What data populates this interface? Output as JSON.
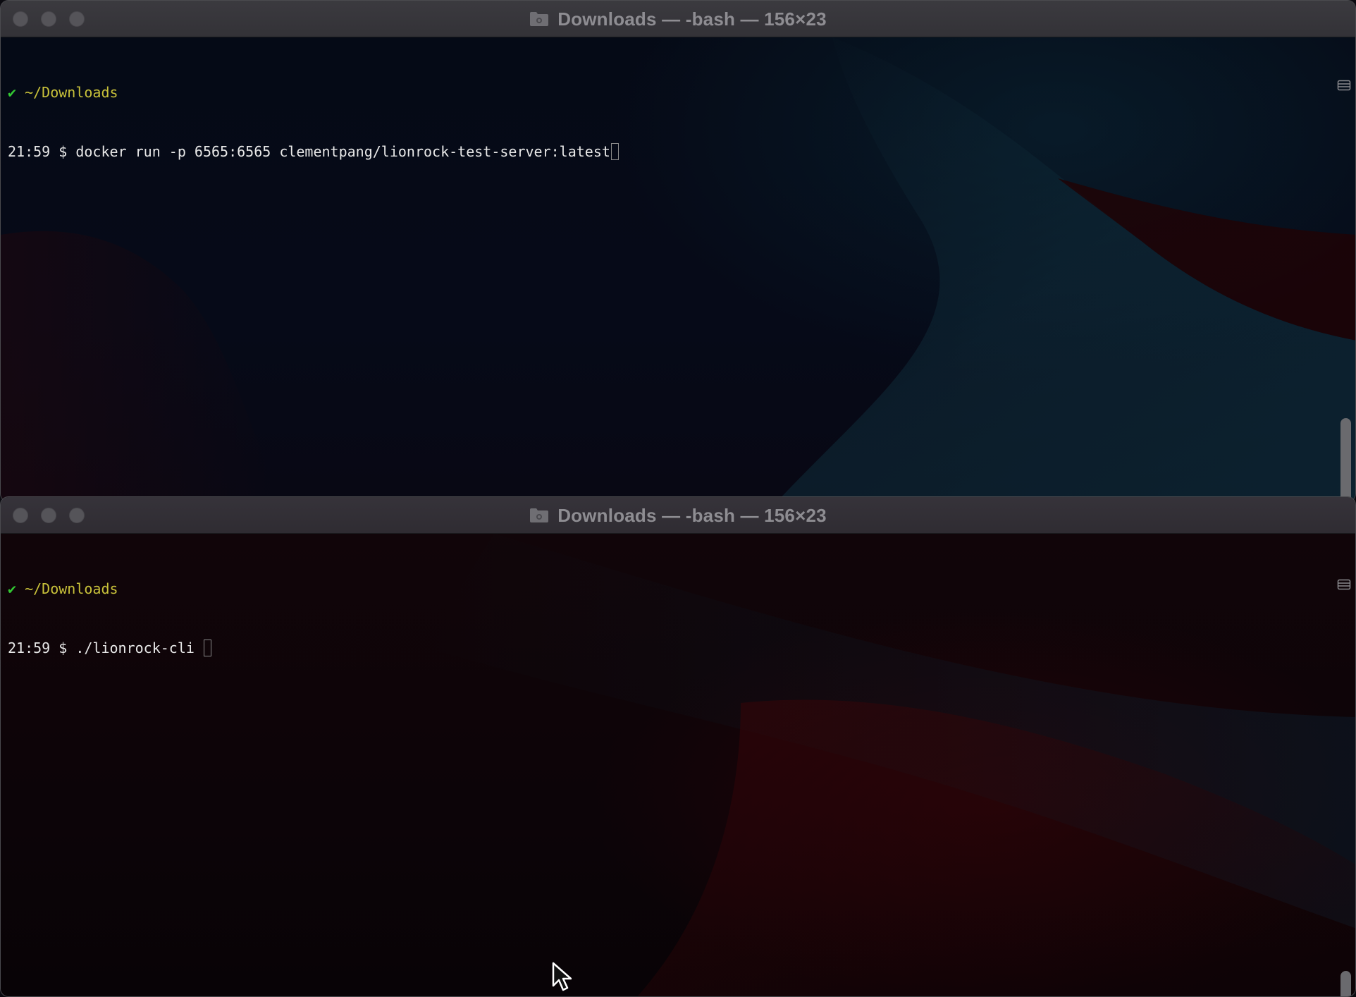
{
  "windows": [
    {
      "title": "Downloads — -bash — 156×23",
      "prompt_check": "✔",
      "prompt_path": "~/Downloads",
      "prompt_time": "21:59 $ ",
      "command": "docker run -p 6565:6565 clementpang/lionrock-test-server:latest"
    },
    {
      "title": "Downloads — -bash — 156×23",
      "prompt_check": "✔",
      "prompt_path": "~/Downloads",
      "prompt_time": "21:59 $ ",
      "command": "./lionrock-cli "
    }
  ],
  "colors": {
    "prompt_check": "#32c832",
    "prompt_path": "#c9c23a",
    "text": "#e8e8e8"
  }
}
